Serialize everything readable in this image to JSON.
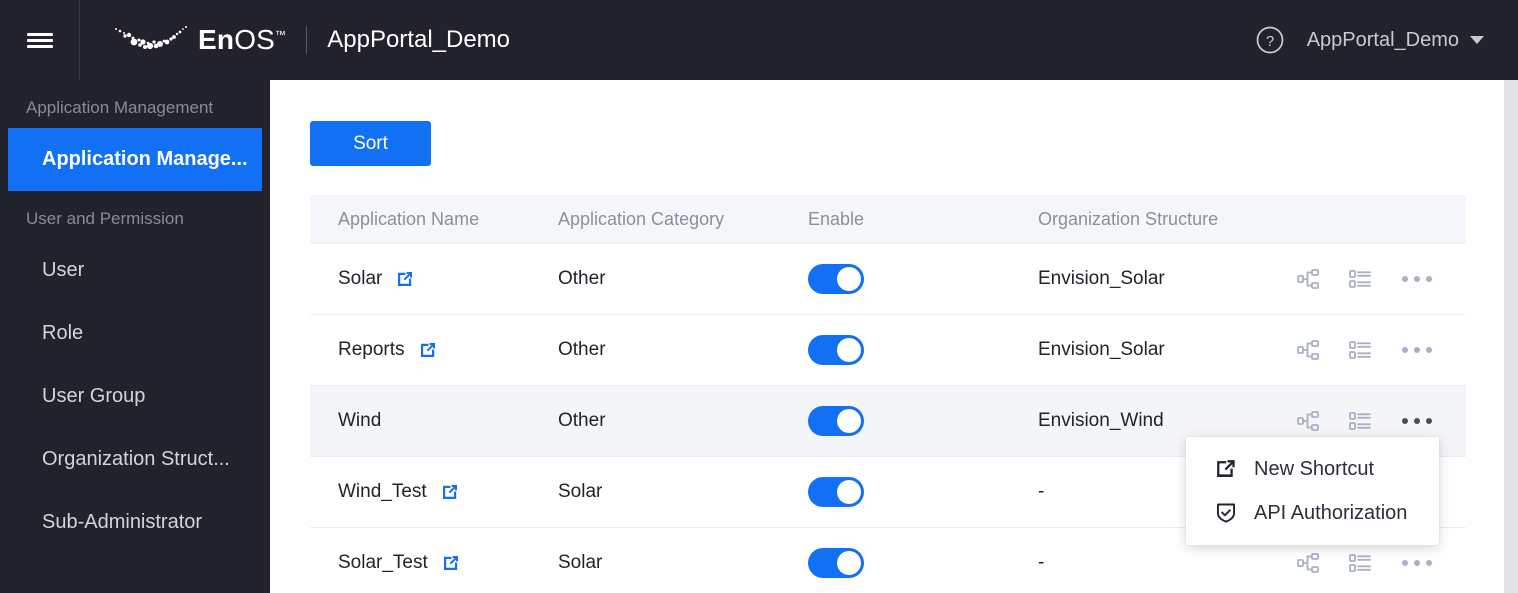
{
  "topbar": {
    "menu_icon": "hamburger-icon",
    "logo_text_bold": "En",
    "logo_text_light": "OS",
    "logo_trademark": "™",
    "app_title": "AppPortal_Demo",
    "help_icon": "question-circle-icon",
    "user_name": "AppPortal_Demo",
    "user_caret_icon": "chevron-down-icon",
    "background": "#22222c"
  },
  "sidebar": {
    "background": "#22222c",
    "active_color": "#1270f4",
    "groups": [
      {
        "title": "Application Management",
        "items": [
          {
            "label": "Application Manage...",
            "active": true
          }
        ]
      },
      {
        "title": "User and Permission",
        "items": [
          {
            "label": "User",
            "active": false
          },
          {
            "label": "Role",
            "active": false
          },
          {
            "label": "User Group",
            "active": false
          },
          {
            "label": "Organization Struct...",
            "active": false
          },
          {
            "label": "Sub-Administrator",
            "active": false
          }
        ]
      }
    ]
  },
  "main": {
    "sort_button_label": "Sort",
    "accent_color": "#1270f4",
    "table": {
      "columns": [
        "Application Name",
        "Application Category",
        "Enable",
        "Organization Structure"
      ],
      "rows": [
        {
          "name": "Solar",
          "has_link": true,
          "category": "Other",
          "enabled": true,
          "org": "Envision_Solar",
          "hovered": false
        },
        {
          "name": "Reports",
          "has_link": true,
          "category": "Other",
          "enabled": true,
          "org": "Envision_Solar",
          "hovered": false
        },
        {
          "name": "Wind",
          "has_link": false,
          "category": "Other",
          "enabled": true,
          "org": "Envision_Wind",
          "hovered": true
        },
        {
          "name": "Wind_Test",
          "has_link": true,
          "category": "Solar",
          "enabled": true,
          "org": "-",
          "hovered": false
        },
        {
          "name": "Solar_Test",
          "has_link": true,
          "category": "Solar",
          "enabled": true,
          "org": "-",
          "hovered": false
        }
      ],
      "row_action_icons": [
        "org-tree-icon",
        "ordered-list-icon",
        "more-ellipsis-icon"
      ]
    },
    "row_menu": {
      "items": [
        {
          "label": "New Shortcut",
          "icon": "external-link-icon"
        },
        {
          "label": "API Authorization",
          "icon": "shield-check-icon"
        }
      ]
    }
  }
}
